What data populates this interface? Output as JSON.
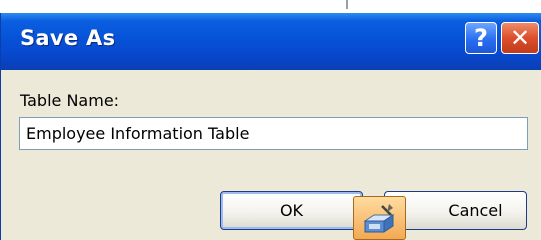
{
  "dialog": {
    "title": "Save As",
    "help_glyph": "?",
    "close_glyph": "✕"
  },
  "form": {
    "table_name_label": "Table Name:",
    "table_name_value": "Employee Information Table"
  },
  "buttons": {
    "ok_label": "OK",
    "cancel_label": "Cancel"
  },
  "icons": {
    "help": "help-icon",
    "close": "close-icon",
    "cursor": "save-object-cursor-icon"
  },
  "colors": {
    "titlebar": "#0652d8",
    "dialog_bg": "#ece9d8",
    "close_button": "#dc4f2c"
  }
}
